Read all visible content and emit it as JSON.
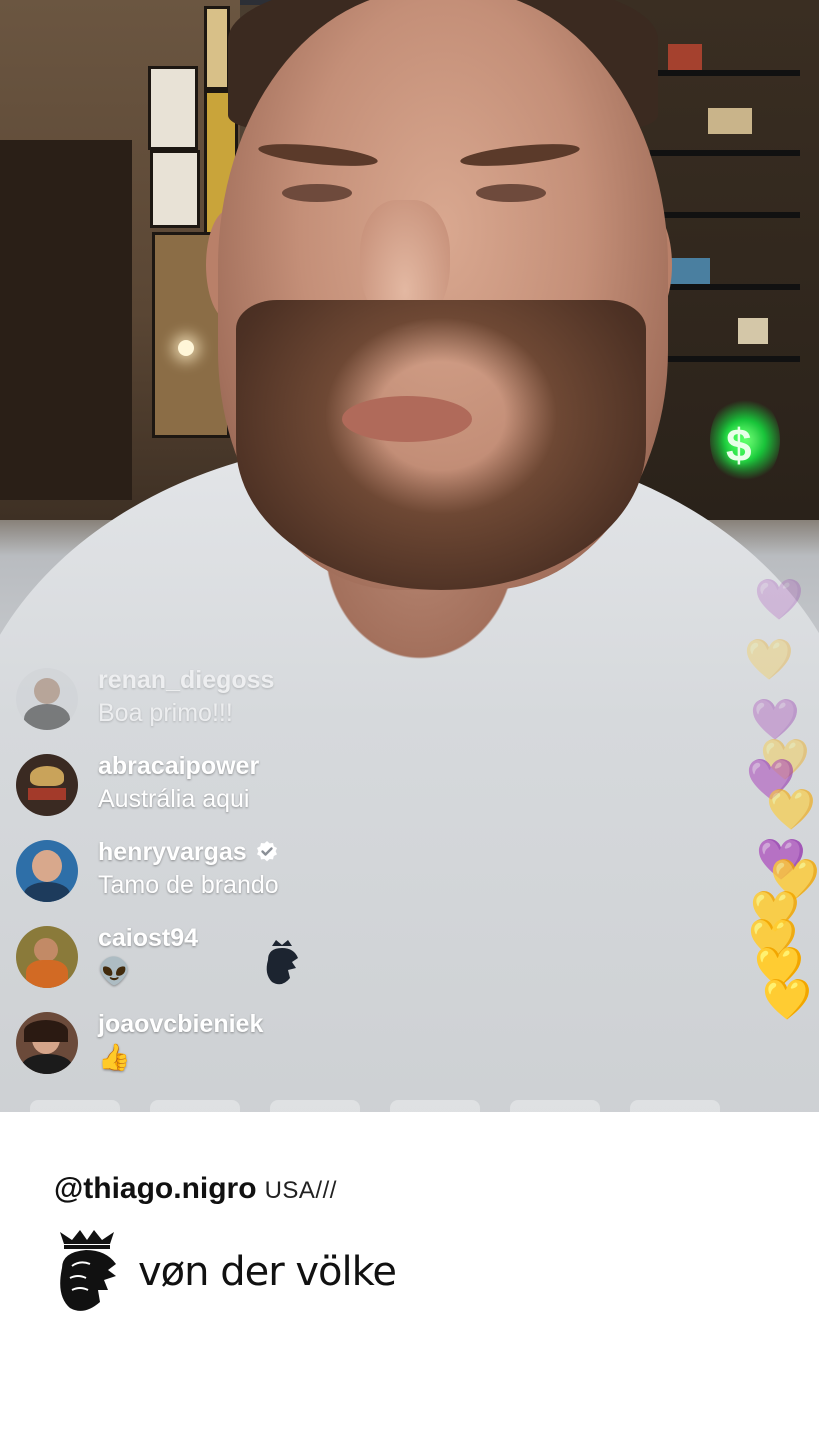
{
  "stream": {
    "comments": [
      {
        "username": "renan_diegoss",
        "text": "Boa primo!!!",
        "verified": false,
        "faded": true,
        "avatar_color": "#cfd2d6"
      },
      {
        "username": "abracaipower",
        "text": "Austrália aqui",
        "verified": false,
        "faded": false,
        "avatar_color": "#3a2a22"
      },
      {
        "username": "henryvargas",
        "text": "Tamo de brando",
        "verified": true,
        "faded": false,
        "avatar_color": "#2e6fa8"
      },
      {
        "username": "caiost94",
        "text": "👽",
        "verified": false,
        "faded": false,
        "avatar_color": "#8a7a3a"
      },
      {
        "username": "joaovcbieniek",
        "text": "👍",
        "verified": false,
        "faded": false,
        "avatar_color": "#6b4a3a"
      }
    ],
    "hearts": [
      "💜",
      "💛",
      "💜",
      "💛",
      "💜",
      "💛",
      "💜",
      "💛",
      "💛",
      "💛",
      "💛",
      "💛"
    ],
    "shelf_sign": "$"
  },
  "caption": {
    "handle": "@thiago.nigro",
    "location": "USA///"
  },
  "brand": {
    "name": "vøn der völke"
  },
  "colors": {
    "background": "#ffffff",
    "text": "#111111",
    "comment_text": "#ffffff"
  }
}
